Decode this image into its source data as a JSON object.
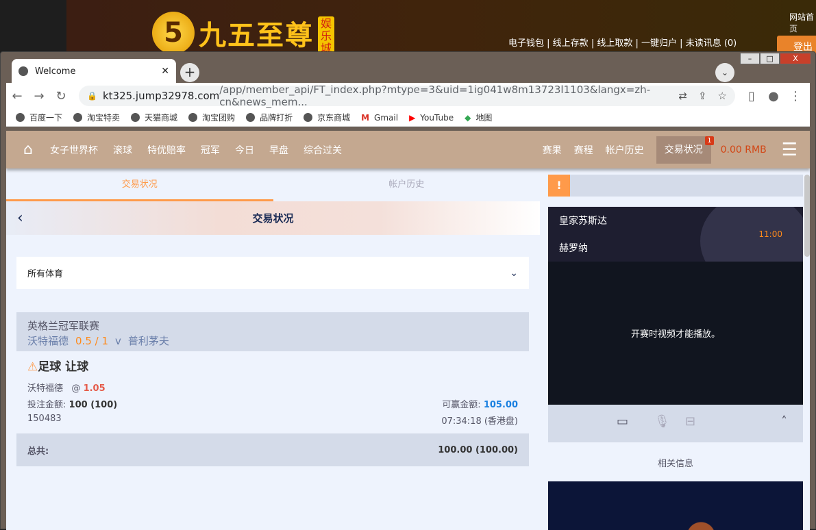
{
  "site": {
    "brand": "九五至尊",
    "brand_tag": "娱乐城",
    "home_link": "网站首页",
    "links": [
      "电子钱包",
      "线上存款",
      "线上取款",
      "一键归户",
      "未读讯息 (0)"
    ],
    "login": "登出"
  },
  "browser": {
    "tab_title": "Welcome",
    "url_host": "kt325.jump32978.com",
    "url_path": "/app/member_api/FT_index.php?mtype=3&uid=1ig041w8m13723l1103&langx=zh-cn&news_mem...",
    "bookmarks": [
      "百度一下",
      "淘宝特卖",
      "天猫商城",
      "淘宝团购",
      "品牌打折",
      "京东商城",
      "Gmail",
      "YouTube",
      "地图"
    ]
  },
  "nav": {
    "items": [
      "女子世界杯",
      "滚球",
      "特优赔率",
      "冠军",
      "今日",
      "早盘",
      "综合过关"
    ],
    "right": [
      "赛果",
      "赛程",
      "帐户历史"
    ],
    "active": "交易状况",
    "badge": "1",
    "balance": "0.00 RMB"
  },
  "left": {
    "tabs": [
      "交易状况",
      "帐户历史"
    ],
    "title": "交易状况",
    "filter": "所有体育",
    "bet": {
      "league": "英格兰冠军联赛",
      "home": "沃特福德",
      "handicap": "0.5 / 1",
      "vs": "v",
      "away": "普利茅夫",
      "type": "足球 让球",
      "pick": "沃特福德",
      "at": "@",
      "odds": "1.05",
      "stake_label": "投注金额:",
      "stake": "100 (100)",
      "win_label": "可赢金额:",
      "win": "105.00",
      "id": "150483",
      "time": "07:34:18 (香港盘)"
    },
    "total_label": "总共:",
    "total": "100.00 (100.00)"
  },
  "right": {
    "home": "皇家苏斯达",
    "away": "赫罗纳",
    "time": "11:00",
    "video_msg": "开赛时视频才能播放。",
    "related": "相关信息"
  }
}
